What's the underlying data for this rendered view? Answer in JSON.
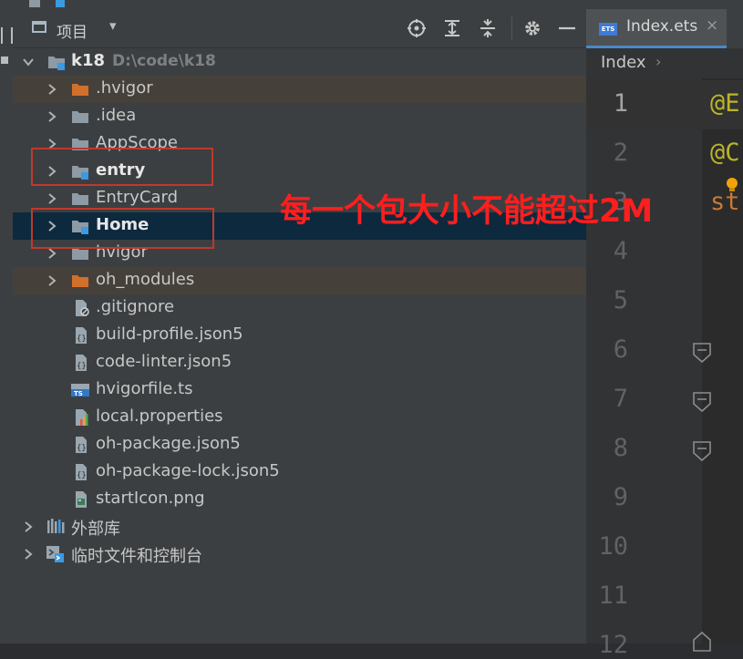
{
  "panel": {
    "title": "项目",
    "dropdown_glyph": "▾"
  },
  "tree": {
    "root": {
      "name": "k18",
      "path": "D:\\code\\k18"
    },
    "items": [
      {
        "label": ".hvigor"
      },
      {
        "label": ".idea"
      },
      {
        "label": "AppScope"
      },
      {
        "label": "entry"
      },
      {
        "label": "EntryCard"
      },
      {
        "label": "Home"
      },
      {
        "label": "hvigor"
      },
      {
        "label": "oh_modules"
      },
      {
        "label": ".gitignore"
      },
      {
        "label": "build-profile.json5"
      },
      {
        "label": "code-linter.json5"
      },
      {
        "label": "hvigorfile.ts"
      },
      {
        "label": "local.properties"
      },
      {
        "label": "oh-package.json5"
      },
      {
        "label": "oh-package-lock.json5"
      },
      {
        "label": "startIcon.png"
      }
    ],
    "external_libs": "外部库",
    "scratches": "临时文件和控制台"
  },
  "annotation": "每一个包大小不能超过2M",
  "editor": {
    "tab_badge": "ETS",
    "tab_name": "Index.ets",
    "tab_close": "×",
    "breadcrumb": "Index",
    "breadcrumb_sep": "›",
    "line_numbers": [
      "1",
      "2",
      "3",
      "4",
      "5",
      "6",
      "7",
      "8",
      "9",
      "10",
      "11",
      "12"
    ],
    "code_lines": [
      "@E",
      "@C",
      "st"
    ]
  },
  "colors": {
    "annotation": "#ff1e1e",
    "folder": "#8e9aa4",
    "excluded_folder": "#d0702a",
    "module_badge": "#3b9ae1",
    "decorator": "#bbb529"
  }
}
